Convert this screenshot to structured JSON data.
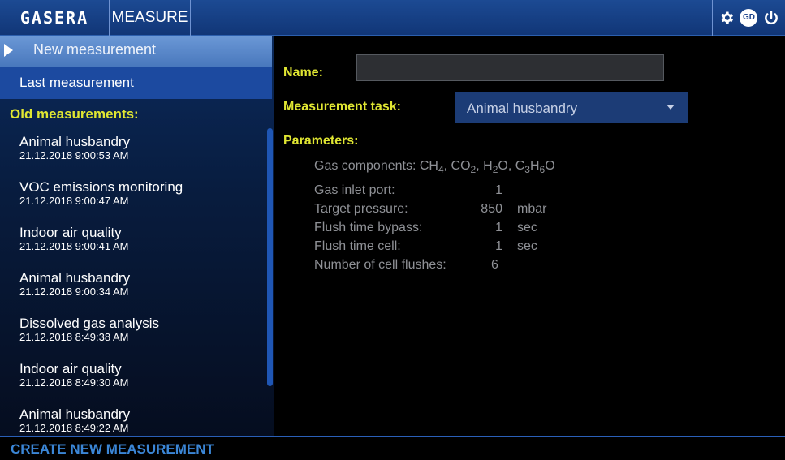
{
  "topbar": {
    "logo": "GASERA",
    "tab_measure": "MEASURE",
    "icons": [
      "gear-icon",
      "gd-icon",
      "power-icon"
    ],
    "gd_label": "GD"
  },
  "nav": {
    "new_measurement": "New measurement",
    "last_measurement": "Last measurement",
    "old_header": "Old measurements:"
  },
  "old_measurements": [
    {
      "name": "Animal husbandry",
      "time": "21.12.2018 9:00:53 AM"
    },
    {
      "name": "VOC emissions monitoring",
      "time": "21.12.2018 9:00:47 AM"
    },
    {
      "name": "Indoor air quality",
      "time": "21.12.2018 9:00:41 AM"
    },
    {
      "name": "Animal husbandry",
      "time": "21.12.2018 9:00:34 AM"
    },
    {
      "name": "Dissolved gas analysis",
      "time": "21.12.2018 8:49:38 AM"
    },
    {
      "name": "Indoor air quality",
      "time": "21.12.2018 8:49:30 AM"
    },
    {
      "name": "Animal husbandry",
      "time": "21.12.2018 8:49:22 AM"
    }
  ],
  "form": {
    "name_label": "Name:",
    "name_value": "",
    "task_label": "Measurement task:",
    "task_value": "Animal husbandry",
    "params_label": "Parameters:",
    "gas_components_label": "Gas components:",
    "params": [
      {
        "label": "Gas inlet port:",
        "value": "1",
        "unit": ""
      },
      {
        "label": "Target pressure:",
        "value": "850",
        "unit": "mbar"
      },
      {
        "label": "Flush time bypass:",
        "value": "1",
        "unit": "sec"
      },
      {
        "label": "Flush time cell:",
        "value": "1",
        "unit": "sec"
      },
      {
        "label": "Number of cell flushes:",
        "value": "6",
        "unit": ""
      }
    ]
  },
  "bottom": {
    "create_label": "CREATE NEW MEASUREMENT"
  },
  "colors": {
    "accent_yellow": "#e0e632",
    "topbar_blue": "#1a418a",
    "selected_blue": "#5a88ca",
    "create_blue": "#3b86d6"
  }
}
